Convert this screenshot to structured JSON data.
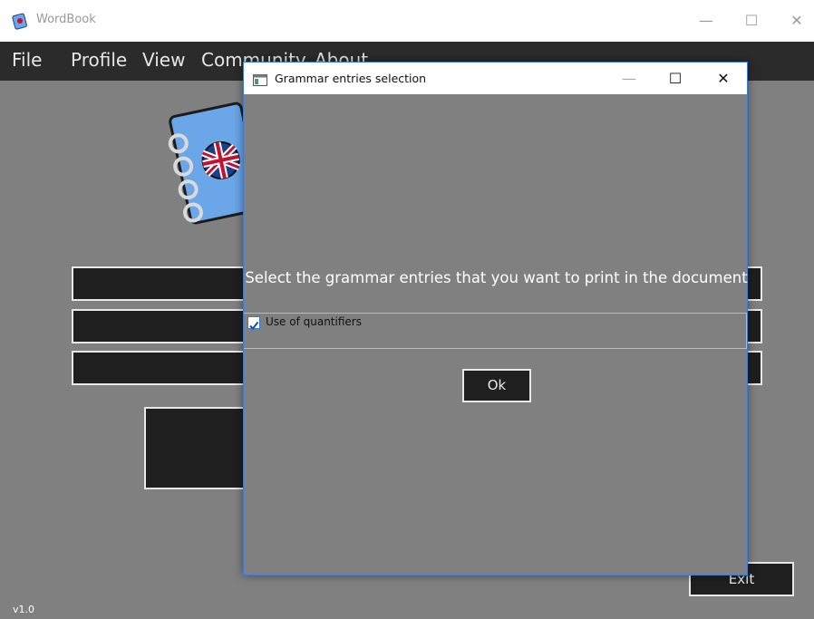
{
  "window": {
    "title": "WordBook",
    "minimize": "—",
    "maximize": "☐",
    "close": "✕"
  },
  "menu": {
    "items": [
      "File",
      "Profile",
      "View",
      "Community",
      "About"
    ]
  },
  "main": {
    "exit_label": "Exit",
    "version": "v1.0"
  },
  "dialog": {
    "title": "Grammar entries selection",
    "minimize": "—",
    "maximize": "☐",
    "close": "✕",
    "heading": "Select the grammar entries that you want to print in the document",
    "entries": [
      {
        "label": "Use of quantifiers",
        "checked": true
      }
    ],
    "ok_label": "Ok"
  },
  "colors": {
    "background": "#808080",
    "menubar": "#2b2b2b",
    "button": "#1f1f1f",
    "accent": "#3a7bd5"
  }
}
